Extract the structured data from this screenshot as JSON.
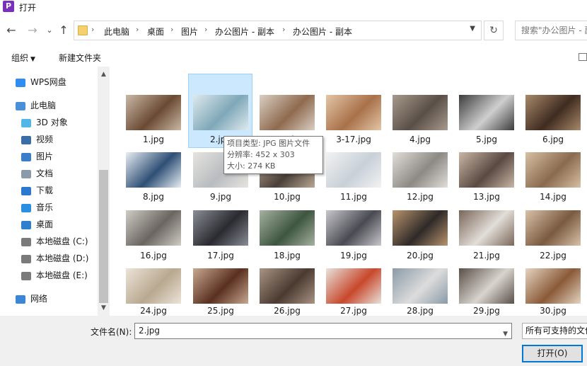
{
  "window": {
    "title": "打开"
  },
  "nav": {
    "back": "←",
    "forward": "→",
    "recent": "⌄",
    "up": "↑"
  },
  "breadcrumb": [
    "此电脑",
    "桌面",
    "图片",
    "办公图片 - 副本",
    "办公图片 - 副本"
  ],
  "search": {
    "placeholder": "搜索\"办公图片 - 副本\""
  },
  "toolbar": {
    "organize": "组织",
    "new_folder": "新建文件夹"
  },
  "sidebar": {
    "items": [
      {
        "label": "WPS网盘",
        "icon": "cloud-icon",
        "color": "#2f8cf0"
      },
      {
        "label": "此电脑",
        "icon": "computer-icon",
        "color": "#4a90d9"
      },
      {
        "label": "3D 对象",
        "icon": "cube-icon",
        "color": "#52b6e8"
      },
      {
        "label": "视频",
        "icon": "video-icon",
        "color": "#3a6ea5"
      },
      {
        "label": "图片",
        "icon": "picture-icon",
        "color": "#3a7dc9"
      },
      {
        "label": "文档",
        "icon": "document-icon",
        "color": "#8a9aa8"
      },
      {
        "label": "下载",
        "icon": "download-icon",
        "color": "#2a78d0"
      },
      {
        "label": "音乐",
        "icon": "music-icon",
        "color": "#2a8fe0"
      },
      {
        "label": "桌面",
        "icon": "desktop-icon",
        "color": "#2f7fcf"
      },
      {
        "label": "本地磁盘 (C:)",
        "icon": "drive-icon",
        "color": "#7a7a7a"
      },
      {
        "label": "本地磁盘 (D:)",
        "icon": "drive-icon",
        "color": "#7a7a7a"
      },
      {
        "label": "本地磁盘 (E:)",
        "icon": "drive-icon",
        "color": "#7a7a7a"
      },
      {
        "label": "网络",
        "icon": "network-icon",
        "color": "#3b86d6"
      }
    ]
  },
  "files": [
    {
      "name": "1.jpg",
      "c1": "#6b4a33",
      "c2": "#c9b8a6"
    },
    {
      "name": "2.jpg",
      "c1": "#7fa8b8",
      "c2": "#dfe9ee"
    },
    {
      "name": "3-17.jpg",
      "c1": "#8f6a4f",
      "c2": "#d9cfc3"
    },
    {
      "name": "3-17.jpg",
      "c1": "#a8714a",
      "c2": "#e4c6a6"
    },
    {
      "name": "4.jpg",
      "c1": "#5a4f48",
      "c2": "#a89a8c"
    },
    {
      "name": "5.jpg",
      "c1": "#cfcfcf",
      "c2": "#3c3c3c"
    },
    {
      "name": "6.jpg",
      "c1": "#3f2b20",
      "c2": "#a88a6a"
    },
    {
      "name": "8.jpg",
      "c1": "#2f4f75",
      "c2": "#e8eef4"
    },
    {
      "name": "9.jpg",
      "c1": "#b8bcc0",
      "c2": "#e6e4df"
    },
    {
      "name": "10.jpg",
      "c1": "#4a3f38",
      "c2": "#b9a894"
    },
    {
      "name": "11.jpg",
      "c1": "#c8d0d8",
      "c2": "#f2f2f2"
    },
    {
      "name": "12.jpg",
      "c1": "#8d8a86",
      "c2": "#e2dfda"
    },
    {
      "name": "13.jpg",
      "c1": "#5a4a42",
      "c2": "#c9b6a4"
    },
    {
      "name": "14.jpg",
      "c1": "#8a6a4e",
      "c2": "#d7c0a4"
    },
    {
      "name": "16.jpg",
      "c1": "#6a6560",
      "c2": "#d0ccc6"
    },
    {
      "name": "17.jpg",
      "c1": "#2a2a30",
      "c2": "#8a8e96"
    },
    {
      "name": "18.jpg",
      "c1": "#3e5540",
      "c2": "#a5b2a0"
    },
    {
      "name": "19.jpg",
      "c1": "#4a4a52",
      "c2": "#c7c7cc"
    },
    {
      "name": "20.jpg",
      "c1": "#2f2a28",
      "c2": "#b9946e"
    },
    {
      "name": "21.jpg",
      "c1": "#e2ded8",
      "c2": "#7a6658"
    },
    {
      "name": "22.jpg",
      "c1": "#7a5a40",
      "c2": "#d8c2a8"
    },
    {
      "name": "24.jpg",
      "c1": "#b8a890",
      "c2": "#ece4d8"
    },
    {
      "name": "25.jpg",
      "c1": "#5a3020",
      "c2": "#c8a890"
    },
    {
      "name": "26.jpg",
      "c1": "#4a3a30",
      "c2": "#a89484"
    },
    {
      "name": "27.jpg",
      "c1": "#c8482c",
      "c2": "#e8e2dc"
    },
    {
      "name": "28.jpg",
      "c1": "#dcdcdc",
      "c2": "#8a9aa8"
    },
    {
      "name": "29.jpg",
      "c1": "#d8d4ce",
      "c2": "#5a5048"
    },
    {
      "name": "30.jpg",
      "c1": "#8a5a38",
      "c2": "#e4d4c0"
    }
  ],
  "tooltip": {
    "line1": "项目类型: JPG 图片文件",
    "line2": "分辨率: 452 x 303",
    "line3": "大小: 274 KB"
  },
  "bottom": {
    "filename_label": "文件名(N):",
    "filename_value": "2.jpg",
    "filetype": "所有可支持的文件",
    "open_button": "打开(O)"
  },
  "colors": {
    "selection_bg": "#cce8ff",
    "selection_border": "#99d1ff",
    "accent": "#0078d7"
  }
}
